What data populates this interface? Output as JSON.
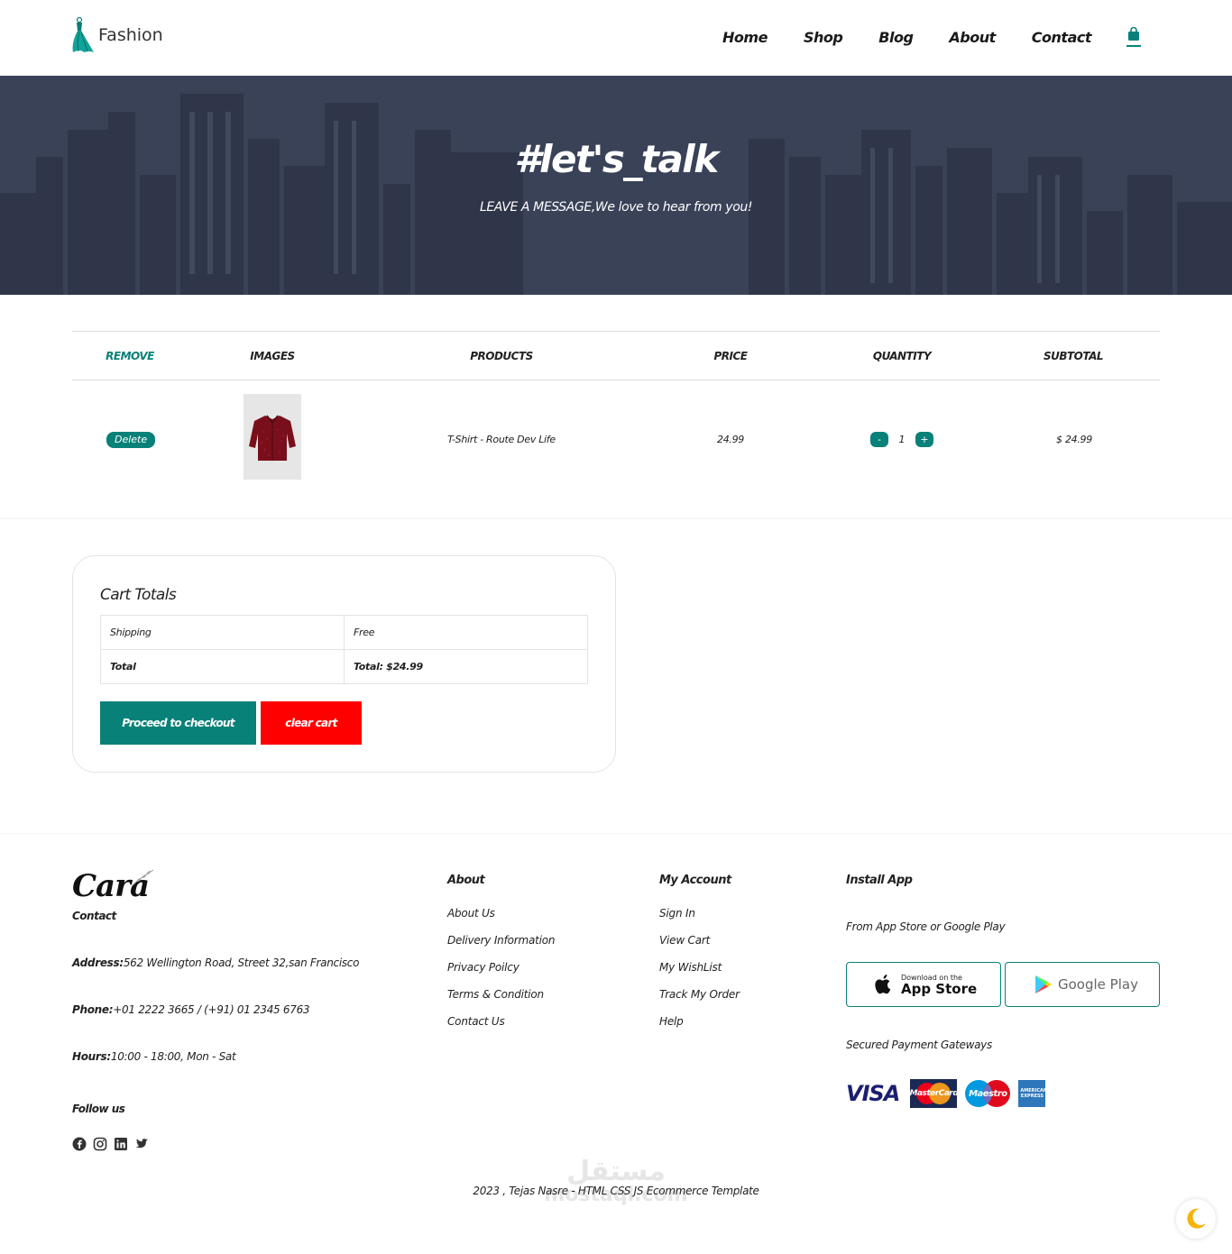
{
  "header": {
    "logo_text": "Fashion",
    "nav": [
      "Home",
      "Shop",
      "Blog",
      "About",
      "Contact"
    ]
  },
  "hero": {
    "title": "#let's_talk",
    "subtitle": "LEAVE A MESSAGE,We love to hear from you!"
  },
  "cart": {
    "columns": [
      "REMOVE",
      "IMAGES",
      "PRODUCTS",
      "PRICE",
      "QUANTITY",
      "SUBTOTAL"
    ],
    "rows": [
      {
        "delete_label": "Delete",
        "product": "T-Shirt - Route Dev Life",
        "price": "24.99",
        "quantity": "1",
        "subtotal": "$ 24.99",
        "decrement": "-",
        "increment": "+"
      }
    ]
  },
  "totals": {
    "title": "Cart Totals",
    "shipping_label": "Shipping",
    "shipping_value": "Free",
    "total_label": "Total",
    "total_value": "Total: $24.99",
    "checkout_label": "Proceed to checkout",
    "clear_label": "clear cart"
  },
  "footer": {
    "brand": "Cara",
    "contact_title": "Contact",
    "address_label": "Address:",
    "address": "562 Wellington Road, Street 32,san Francisco",
    "phone_label": "Phone:",
    "phone": "+01 2222 3665 / (+91) 01 2345 6763",
    "hours_label": "Hours:",
    "hours": "10:00 - 18:00, Mon - Sat",
    "follow_title": "Follow us",
    "about_title": "About",
    "about_links": [
      "About Us",
      "Delivery Information",
      "Privacy Poilcy",
      "Terms & Condition",
      "Contact Us"
    ],
    "account_title": "My Account",
    "account_links": [
      "Sign In",
      "View Cart",
      "My WishList",
      "Track My Order",
      "Help"
    ],
    "install_title": "Install App",
    "install_text": "From App Store or Google Play",
    "appstore_small": "Download on the",
    "appstore_big": "App Store",
    "googleplay": "Google Play",
    "payment_title": "Secured Payment Gateways",
    "visa": "VISA",
    "mastercard": "MasterCard",
    "maestro": "Maestro",
    "amex": "AMERICAN EXPRESS",
    "copyright": "2023 , Tejas Nasre - HTML CSS JS Ecommerce Template"
  },
  "watermark": {
    "arabic": "مستقل",
    "latin": "mostaql.com"
  },
  "colors": {
    "accent": "#088178",
    "danger": "#ff0000",
    "hero_bg": "#3a4258"
  }
}
